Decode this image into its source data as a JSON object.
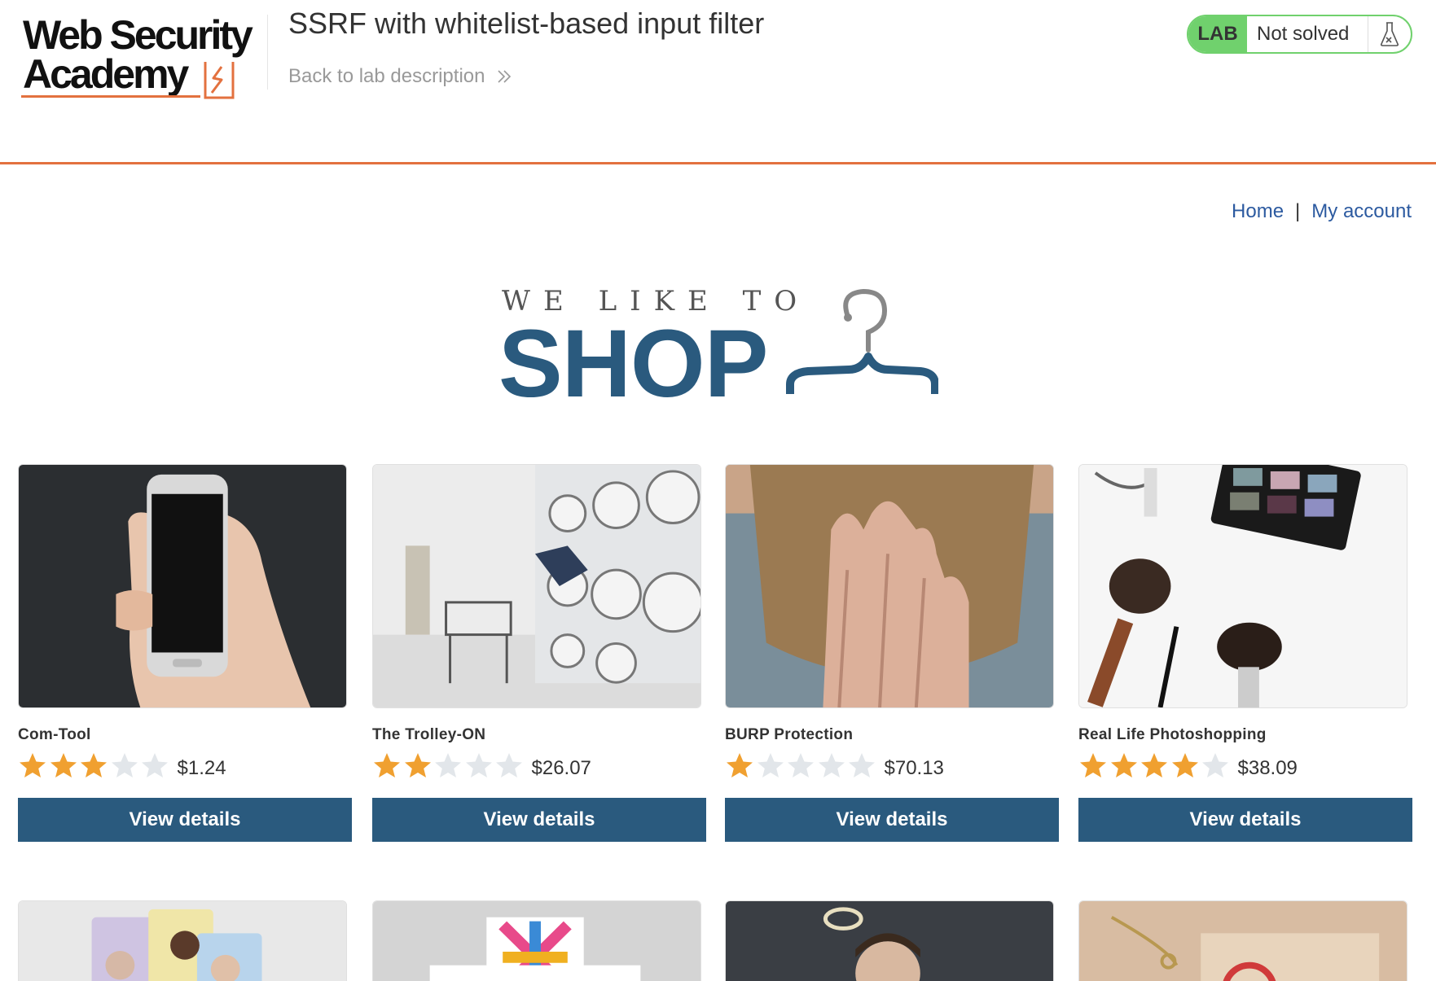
{
  "header": {
    "logo_line1": "Web Security",
    "logo_line2": "Academy",
    "lab_title": "SSRF with whitelist-based input filter",
    "back_link": "Back to lab description",
    "lab_badge": "LAB",
    "lab_status": "Not solved"
  },
  "nav": {
    "home": "Home",
    "separator": "|",
    "my_account": "My account"
  },
  "banner": {
    "tagline": "WE LIKE TO",
    "shop": "SHOP"
  },
  "products": [
    {
      "name": "Com-Tool",
      "rating": 3,
      "price": "$1.24",
      "button": "View details",
      "image_icon": "smartphone-image"
    },
    {
      "name": "The Trolley-ON",
      "rating": 2,
      "price": "$26.07",
      "button": "View details",
      "image_icon": "laundromat-image"
    },
    {
      "name": "BURP Protection",
      "rating": 1,
      "price": "$70.13",
      "button": "View details",
      "image_icon": "beard-hand-image"
    },
    {
      "name": "Real Life Photoshopping",
      "rating": 4,
      "price": "$38.09",
      "button": "View details",
      "image_icon": "makeup-brushes-image"
    }
  ],
  "products_row2": [
    {
      "image_icon": "people-cards-image"
    },
    {
      "image_icon": "team-banner-image"
    },
    {
      "image_icon": "halo-man-image"
    },
    {
      "image_icon": "hanging-sign-image"
    }
  ],
  "colors": {
    "accent_orange": "#e3713f",
    "brand_blue": "#2a5a7e",
    "lab_green": "#70d16d",
    "star_filled": "#f0a030",
    "star_empty": "#e2e6ea",
    "link_blue": "#2c5aa0"
  }
}
